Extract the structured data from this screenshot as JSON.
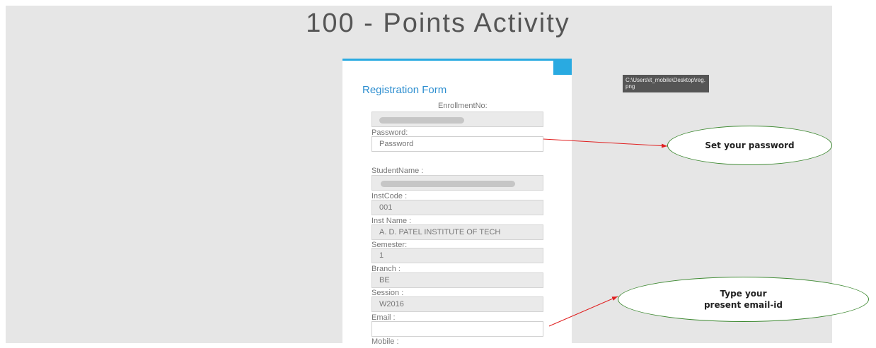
{
  "page": {
    "title": "100 - Points Activity"
  },
  "form": {
    "heading": "Registration Form",
    "enrollment_label": "EnrollmentNo:",
    "password_label": "Password:",
    "password_placeholder": "Password",
    "student_name_label": "StudentName :",
    "inst_code_label": "InstCode :",
    "inst_code_value": "001",
    "inst_name_label": "Inst Name :",
    "inst_name_value": "A. D. PATEL INSTITUTE OF TECH",
    "semester_label": "Semester:",
    "semester_value": "1",
    "branch_label": "Branch :",
    "branch_value": "BE",
    "session_label": "Session :",
    "session_value": "W2016",
    "email_label": "Email :",
    "email_value": "",
    "mobile_label": "Mobile :"
  },
  "tooltip": {
    "text": "C:\\Users\\it_mobile\\Desktop\\reg.png"
  },
  "callouts": {
    "password": "Set your password",
    "email": "Type your present email-id"
  },
  "colors": {
    "accent": "#29aae1",
    "heading": "#2f8fd0",
    "arrow": "#e02020",
    "callout_border": "#3f8a33"
  }
}
